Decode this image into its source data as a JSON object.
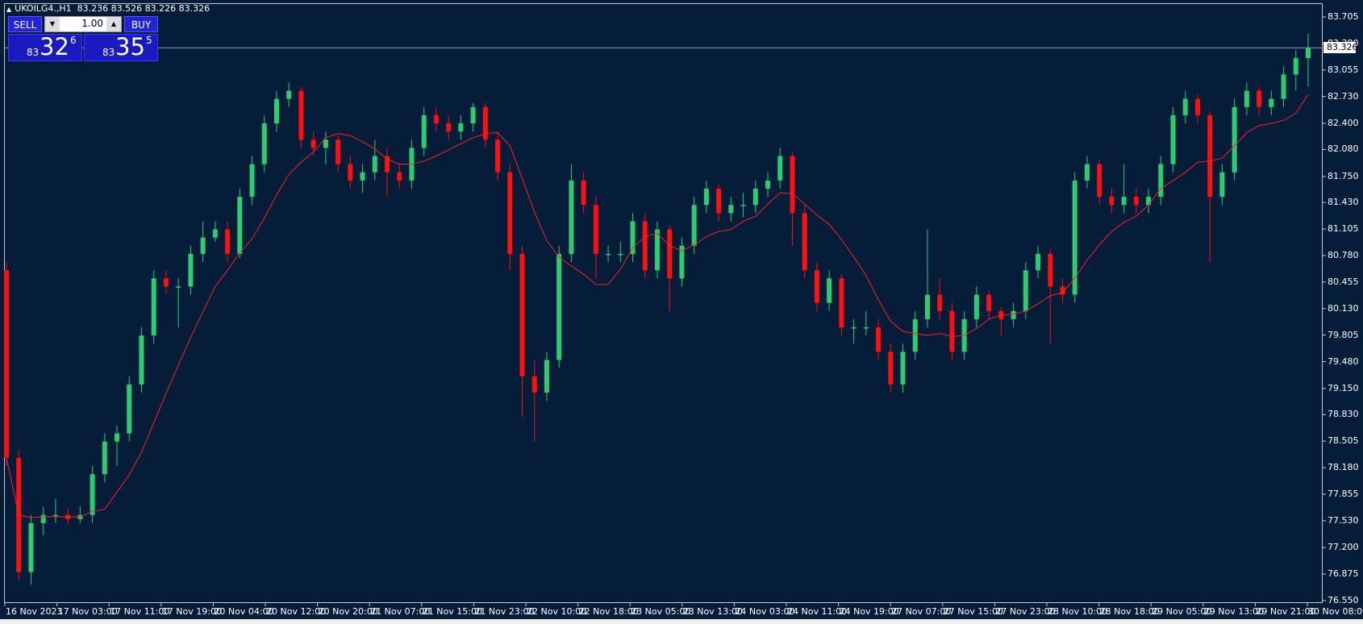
{
  "header": {
    "symbol": "UKOILG4.,H1",
    "ohlc_text": "83.236 83.526 83.226 83.326"
  },
  "trade_panel": {
    "sell_label": "SELL",
    "buy_label": "BUY",
    "lot": "1.00",
    "bid": {
      "prefix": "83",
      "big": "32",
      "pip": "6"
    },
    "ask": {
      "prefix": "83",
      "big": "35",
      "pip": "5"
    }
  },
  "colors": {
    "background": "#061d3a",
    "up": "#2ecc71",
    "down": "#ff1010",
    "ma": "#ff2020",
    "price_line": "#8aa0b0"
  },
  "chart_data": {
    "type": "candlestick",
    "ylim": [
      76.55,
      83.705
    ],
    "current_price": "83.326",
    "y_ticks": [
      "83.705",
      "83.380",
      "83.055",
      "82.730",
      "82.400",
      "82.080",
      "81.750",
      "81.430",
      "81.105",
      "80.780",
      "80.455",
      "80.130",
      "79.805",
      "79.480",
      "79.150",
      "78.830",
      "78.505",
      "78.180",
      "77.855",
      "77.530",
      "77.200",
      "76.875",
      "76.550"
    ],
    "x_ticks": [
      "16 Nov 2023",
      "17 Nov 03:00",
      "17 Nov 11:00",
      "17 Nov 19:00",
      "20 Nov 04:00",
      "20 Nov 12:00",
      "20 Nov 20:00",
      "21 Nov 07:00",
      "21 Nov 15:00",
      "21 Nov 23:00",
      "22 Nov 10:00",
      "22 Nov 18:00",
      "23 Nov 05:00",
      "23 Nov 13:00",
      "24 Nov 03:00",
      "24 Nov 11:00",
      "24 Nov 19:00",
      "27 Nov 07:00",
      "27 Nov 15:00",
      "27 Nov 23:00",
      "28 Nov 10:00",
      "28 Nov 18:00",
      "29 Nov 05:00",
      "29 Nov 13:00",
      "29 Nov 21:00",
      "30 Nov 08:00"
    ],
    "indicator": {
      "type": "moving-average",
      "period": 8
    },
    "candles_ohlc": [
      [
        80.6,
        80.7,
        78.2,
        78.3
      ],
      [
        78.3,
        78.4,
        76.8,
        76.9
      ],
      [
        76.9,
        77.6,
        76.75,
        77.5
      ],
      [
        77.5,
        77.7,
        77.35,
        77.6
      ],
      [
        77.6,
        77.8,
        77.5,
        77.6
      ],
      [
        77.6,
        77.68,
        77.48,
        77.55
      ],
      [
        77.55,
        77.7,
        77.5,
        77.6
      ],
      [
        77.6,
        78.2,
        77.5,
        78.1
      ],
      [
        78.1,
        78.6,
        78.0,
        78.5
      ],
      [
        78.5,
        78.7,
        78.2,
        78.6
      ],
      [
        78.6,
        79.3,
        78.5,
        79.2
      ],
      [
        79.2,
        79.9,
        79.1,
        79.8
      ],
      [
        79.8,
        80.6,
        79.7,
        80.5
      ],
      [
        80.5,
        80.6,
        80.3,
        80.4
      ],
      [
        80.4,
        80.5,
        79.9,
        80.4
      ],
      [
        80.4,
        80.9,
        80.3,
        80.8
      ],
      [
        80.8,
        81.2,
        80.7,
        81.0
      ],
      [
        81.0,
        81.2,
        80.95,
        81.1
      ],
      [
        81.1,
        81.2,
        80.7,
        80.8
      ],
      [
        80.8,
        81.6,
        80.75,
        81.5
      ],
      [
        81.5,
        82.0,
        81.4,
        81.9
      ],
      [
        81.9,
        82.5,
        81.8,
        82.4
      ],
      [
        82.4,
        82.8,
        82.3,
        82.7
      ],
      [
        82.7,
        82.9,
        82.6,
        82.8
      ],
      [
        82.8,
        82.85,
        82.1,
        82.2
      ],
      [
        82.2,
        82.3,
        82.0,
        82.1
      ],
      [
        82.1,
        82.3,
        81.9,
        82.2
      ],
      [
        82.2,
        82.25,
        81.8,
        81.9
      ],
      [
        81.9,
        82.0,
        81.6,
        81.7
      ],
      [
        81.7,
        81.9,
        81.55,
        81.8
      ],
      [
        81.8,
        82.2,
        81.7,
        82.0
      ],
      [
        82.0,
        82.1,
        81.5,
        81.8
      ],
      [
        81.8,
        81.9,
        81.6,
        81.7
      ],
      [
        81.7,
        82.2,
        81.6,
        82.1
      ],
      [
        82.1,
        82.6,
        82.0,
        82.5
      ],
      [
        82.5,
        82.6,
        82.3,
        82.4
      ],
      [
        82.4,
        82.5,
        82.2,
        82.3
      ],
      [
        82.3,
        82.5,
        82.2,
        82.4
      ],
      [
        82.4,
        82.65,
        82.3,
        82.6
      ],
      [
        82.6,
        82.65,
        82.1,
        82.2
      ],
      [
        82.2,
        82.3,
        81.7,
        81.8
      ],
      [
        81.8,
        81.9,
        80.6,
        80.8
      ],
      [
        80.8,
        80.9,
        78.8,
        79.3
      ],
      [
        79.3,
        79.5,
        78.5,
        79.1
      ],
      [
        79.1,
        79.6,
        79.0,
        79.5
      ],
      [
        79.5,
        80.9,
        79.4,
        80.8
      ],
      [
        80.8,
        81.9,
        80.7,
        81.7
      ],
      [
        81.7,
        81.8,
        81.3,
        81.4
      ],
      [
        81.4,
        81.5,
        80.5,
        80.8
      ],
      [
        80.8,
        80.9,
        80.7,
        80.8
      ],
      [
        80.8,
        80.95,
        80.7,
        80.8
      ],
      [
        80.8,
        81.3,
        80.7,
        81.2
      ],
      [
        81.2,
        81.3,
        80.5,
        80.6
      ],
      [
        80.6,
        81.2,
        80.5,
        81.1
      ],
      [
        81.1,
        81.15,
        80.1,
        80.5
      ],
      [
        80.5,
        81.0,
        80.4,
        80.9
      ],
      [
        80.9,
        81.5,
        80.8,
        81.4
      ],
      [
        81.4,
        81.7,
        81.3,
        81.6
      ],
      [
        81.6,
        81.65,
        81.2,
        81.3
      ],
      [
        81.3,
        81.5,
        81.2,
        81.4
      ],
      [
        81.4,
        81.55,
        81.25,
        81.4
      ],
      [
        81.4,
        81.7,
        81.3,
        81.6
      ],
      [
        81.6,
        81.8,
        81.5,
        81.7
      ],
      [
        81.7,
        82.1,
        81.6,
        82.0
      ],
      [
        82.0,
        82.05,
        80.9,
        81.3
      ],
      [
        81.3,
        81.4,
        80.5,
        80.6
      ],
      [
        80.6,
        80.7,
        80.1,
        80.2
      ],
      [
        80.2,
        80.6,
        80.1,
        80.5
      ],
      [
        80.5,
        80.55,
        79.8,
        79.9
      ],
      [
        79.9,
        80.0,
        79.7,
        79.9
      ],
      [
        79.9,
        80.1,
        79.8,
        79.9
      ],
      [
        79.9,
        80.0,
        79.5,
        79.6
      ],
      [
        79.6,
        79.7,
        79.1,
        79.2
      ],
      [
        79.2,
        79.7,
        79.1,
        79.6
      ],
      [
        79.6,
        80.1,
        79.5,
        80.0
      ],
      [
        80.0,
        81.1,
        79.9,
        80.3
      ],
      [
        80.3,
        80.5,
        80.0,
        80.1
      ],
      [
        80.1,
        80.2,
        79.5,
        79.6
      ],
      [
        79.6,
        80.1,
        79.5,
        80.0
      ],
      [
        80.0,
        80.4,
        79.9,
        80.3
      ],
      [
        80.3,
        80.35,
        80.0,
        80.1
      ],
      [
        80.1,
        80.15,
        79.8,
        80.0
      ],
      [
        80.0,
        80.2,
        79.9,
        80.1
      ],
      [
        80.1,
        80.7,
        80.0,
        80.6
      ],
      [
        80.6,
        80.9,
        80.5,
        80.8
      ],
      [
        80.8,
        80.85,
        79.7,
        80.4
      ],
      [
        80.4,
        80.5,
        80.2,
        80.3
      ],
      [
        80.3,
        81.8,
        80.2,
        81.7
      ],
      [
        81.7,
        82.0,
        81.6,
        81.9
      ],
      [
        81.9,
        81.95,
        81.4,
        81.5
      ],
      [
        81.5,
        81.6,
        81.3,
        81.4
      ],
      [
        81.4,
        81.9,
        81.3,
        81.5
      ],
      [
        81.5,
        81.6,
        81.3,
        81.4
      ],
      [
        81.4,
        81.6,
        81.3,
        81.5
      ],
      [
        81.5,
        82.0,
        81.4,
        81.9
      ],
      [
        81.9,
        82.6,
        81.8,
        82.5
      ],
      [
        82.5,
        82.8,
        82.4,
        82.7
      ],
      [
        82.7,
        82.75,
        82.4,
        82.5
      ],
      [
        82.5,
        82.55,
        80.7,
        81.5
      ],
      [
        81.5,
        81.9,
        81.4,
        81.8
      ],
      [
        81.8,
        82.7,
        81.7,
        82.6
      ],
      [
        82.6,
        82.9,
        82.5,
        82.8
      ],
      [
        82.8,
        82.85,
        82.5,
        82.6
      ],
      [
        82.6,
        82.8,
        82.5,
        82.7
      ],
      [
        82.7,
        83.1,
        82.6,
        83.0
      ],
      [
        83.0,
        83.3,
        82.8,
        83.2
      ],
      [
        83.2,
        83.5,
        82.85,
        83.326
      ]
    ]
  }
}
